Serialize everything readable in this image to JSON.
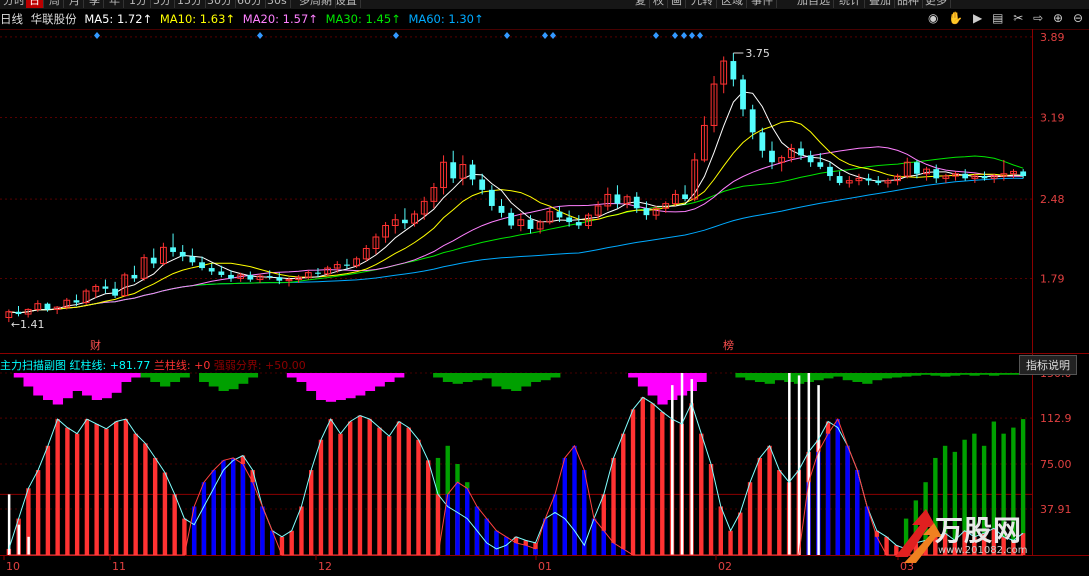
{
  "toolbar": {
    "left": [
      {
        "label": "分时",
        "active": false
      },
      {
        "label": "日",
        "active": true
      },
      {
        "label": "周",
        "active": false
      },
      {
        "label": "月",
        "active": false
      },
      {
        "label": "季",
        "active": false
      },
      {
        "label": "年",
        "active": false
      },
      {
        "label": "1分",
        "active": false
      },
      {
        "label": "5分",
        "active": false
      },
      {
        "label": "15分",
        "active": false
      },
      {
        "label": "30分",
        "active": false
      },
      {
        "label": "60分",
        "active": false
      },
      {
        "label": "30s",
        "active": false
      },
      {
        "label": "多周期",
        "active": false
      },
      {
        "label": "设置",
        "active": false
      }
    ],
    "right": [
      "复",
      "权",
      "画",
      "九转",
      "区域",
      "事件",
      "加自选",
      "统计",
      "叠加",
      "品种",
      "更多"
    ]
  },
  "header": {
    "period": "日线",
    "stock_name": "华联股份",
    "ma5": "MA5: 1.72↑",
    "ma10": "MA10: 1.63↑",
    "ma20": "MA20: 1.57↑",
    "ma30": "MA30: 1.45↑",
    "ma60": "MA60: 1.30↑"
  },
  "colors": {
    "up": "#ff3232",
    "down": "#54fcfc",
    "ma5": "#ffffff",
    "ma10": "#ffff00",
    "ma20": "#ff80ff",
    "ma30": "#00e600",
    "ma60": "#00aaff",
    "grid": "#8b0000",
    "magenta": "#ff00ff",
    "green": "#00a000",
    "blue": "#0000ff"
  },
  "price_axis": [
    "3.89",
    "3.19",
    "2.48",
    "1.79"
  ],
  "price_annotations": {
    "high": "3.75",
    "low": "1.41"
  },
  "event_markers": [
    "财",
    "榜"
  ],
  "indicator": {
    "name": "主力扫描副图",
    "red_line": "红柱线: +81.77",
    "blue_line": "兰柱线: +0",
    "boundary": "强弱分界: +50.00",
    "help_button": "指标说明",
    "axis": [
      "150.0",
      "112.9",
      "75.00",
      "37.91"
    ]
  },
  "x_axis": [
    "10",
    "11",
    "12",
    "01",
    "02",
    "03"
  ],
  "watermark": "万股网",
  "watermark_url": "www.201082.com",
  "toolbar_icons": [
    "eye-icon",
    "hand-icon",
    "play-icon",
    "chart-icon",
    "scissors-icon",
    "arrow-icon",
    "zoom-in-icon",
    "zoom-out-icon"
  ],
  "chart_data": {
    "type": "candlestick",
    "price_range": [
      1.41,
      3.89
    ],
    "ohlc": [
      [
        1.45,
        1.52,
        1.41,
        1.5
      ],
      [
        1.5,
        1.55,
        1.46,
        1.48
      ],
      [
        1.48,
        1.53,
        1.45,
        1.52
      ],
      [
        1.52,
        1.6,
        1.5,
        1.57
      ],
      [
        1.57,
        1.58,
        1.5,
        1.52
      ],
      [
        1.52,
        1.55,
        1.48,
        1.54
      ],
      [
        1.54,
        1.62,
        1.52,
        1.6
      ],
      [
        1.6,
        1.65,
        1.55,
        1.58
      ],
      [
        1.58,
        1.7,
        1.56,
        1.68
      ],
      [
        1.68,
        1.74,
        1.62,
        1.72
      ],
      [
        1.72,
        1.78,
        1.66,
        1.7
      ],
      [
        1.7,
        1.76,
        1.62,
        1.64
      ],
      [
        1.64,
        1.84,
        1.63,
        1.82
      ],
      [
        1.82,
        1.9,
        1.76,
        1.79
      ],
      [
        1.79,
        2.0,
        1.77,
        1.97
      ],
      [
        1.97,
        2.05,
        1.88,
        1.92
      ],
      [
        1.92,
        2.1,
        1.9,
        2.06
      ],
      [
        2.06,
        2.18,
        1.98,
        2.02
      ],
      [
        2.02,
        2.08,
        1.94,
        1.98
      ],
      [
        1.98,
        2.05,
        1.9,
        1.93
      ],
      [
        1.93,
        1.98,
        1.86,
        1.88
      ],
      [
        1.88,
        1.92,
        1.82,
        1.85
      ],
      [
        1.85,
        1.9,
        1.8,
        1.82
      ],
      [
        1.82,
        1.86,
        1.76,
        1.79
      ],
      [
        1.79,
        1.84,
        1.76,
        1.82
      ],
      [
        1.82,
        1.85,
        1.76,
        1.78
      ],
      [
        1.78,
        1.83,
        1.75,
        1.81
      ],
      [
        1.81,
        1.86,
        1.78,
        1.8
      ],
      [
        1.8,
        1.84,
        1.74,
        1.77
      ],
      [
        1.77,
        1.8,
        1.72,
        1.78
      ],
      [
        1.78,
        1.82,
        1.75,
        1.8
      ],
      [
        1.8,
        1.86,
        1.78,
        1.84
      ],
      [
        1.84,
        1.88,
        1.8,
        1.83
      ],
      [
        1.83,
        1.9,
        1.81,
        1.88
      ],
      [
        1.88,
        1.94,
        1.84,
        1.91
      ],
      [
        1.91,
        1.96,
        1.87,
        1.9
      ],
      [
        1.9,
        1.98,
        1.88,
        1.96
      ],
      [
        1.96,
        2.08,
        1.94,
        2.05
      ],
      [
        2.05,
        2.18,
        2.0,
        2.15
      ],
      [
        2.15,
        2.28,
        2.1,
        2.25
      ],
      [
        2.25,
        2.35,
        2.18,
        2.3
      ],
      [
        2.3,
        2.4,
        2.22,
        2.27
      ],
      [
        2.27,
        2.38,
        2.24,
        2.35
      ],
      [
        2.35,
        2.5,
        2.3,
        2.46
      ],
      [
        2.46,
        2.62,
        2.4,
        2.58
      ],
      [
        2.58,
        2.86,
        2.52,
        2.8
      ],
      [
        2.8,
        2.9,
        2.62,
        2.66
      ],
      [
        2.66,
        2.86,
        2.6,
        2.78
      ],
      [
        2.78,
        2.82,
        2.6,
        2.65
      ],
      [
        2.65,
        2.7,
        2.52,
        2.56
      ],
      [
        2.56,
        2.6,
        2.38,
        2.42
      ],
      [
        2.42,
        2.48,
        2.32,
        2.36
      ],
      [
        2.36,
        2.4,
        2.22,
        2.25
      ],
      [
        2.25,
        2.36,
        2.2,
        2.3
      ],
      [
        2.3,
        2.34,
        2.18,
        2.22
      ],
      [
        2.22,
        2.3,
        2.18,
        2.28
      ],
      [
        2.28,
        2.4,
        2.26,
        2.37
      ],
      [
        2.37,
        2.42,
        2.28,
        2.32
      ],
      [
        2.32,
        2.38,
        2.24,
        2.28
      ],
      [
        2.28,
        2.34,
        2.22,
        2.25
      ],
      [
        2.25,
        2.36,
        2.22,
        2.34
      ],
      [
        2.34,
        2.46,
        2.3,
        2.42
      ],
      [
        2.42,
        2.58,
        2.38,
        2.52
      ],
      [
        2.52,
        2.6,
        2.4,
        2.44
      ],
      [
        2.44,
        2.52,
        2.4,
        2.5
      ],
      [
        2.5,
        2.54,
        2.36,
        2.4
      ],
      [
        2.4,
        2.46,
        2.3,
        2.34
      ],
      [
        2.34,
        2.42,
        2.3,
        2.4
      ],
      [
        2.4,
        2.46,
        2.36,
        2.44
      ],
      [
        2.44,
        2.56,
        2.42,
        2.52
      ],
      [
        2.52,
        2.6,
        2.46,
        2.48
      ],
      [
        2.48,
        2.88,
        2.46,
        2.82
      ],
      [
        2.82,
        3.2,
        2.8,
        3.12
      ],
      [
        3.12,
        3.55,
        3.06,
        3.48
      ],
      [
        3.48,
        3.72,
        3.4,
        3.68
      ],
      [
        3.68,
        3.75,
        3.46,
        3.52
      ],
      [
        3.52,
        3.56,
        3.2,
        3.26
      ],
      [
        3.26,
        3.3,
        3.0,
        3.06
      ],
      [
        3.06,
        3.1,
        2.84,
        2.9
      ],
      [
        2.9,
        2.98,
        2.74,
        2.8
      ],
      [
        2.8,
        2.86,
        2.72,
        2.84
      ],
      [
        2.84,
        2.96,
        2.8,
        2.92
      ],
      [
        2.92,
        2.98,
        2.82,
        2.86
      ],
      [
        2.86,
        2.9,
        2.76,
        2.8
      ],
      [
        2.8,
        2.88,
        2.74,
        2.76
      ],
      [
        2.76,
        2.8,
        2.64,
        2.68
      ],
      [
        2.68,
        2.72,
        2.6,
        2.62
      ],
      [
        2.62,
        2.68,
        2.58,
        2.64
      ],
      [
        2.64,
        2.7,
        2.6,
        2.66
      ],
      [
        2.66,
        2.7,
        2.6,
        2.64
      ],
      [
        2.64,
        2.68,
        2.6,
        2.62
      ],
      [
        2.62,
        2.66,
        2.58,
        2.64
      ],
      [
        2.64,
        2.7,
        2.6,
        2.68
      ],
      [
        2.68,
        2.84,
        2.66,
        2.8
      ],
      [
        2.8,
        2.82,
        2.66,
        2.7
      ],
      [
        2.7,
        2.76,
        2.64,
        2.74
      ],
      [
        2.74,
        2.78,
        2.62,
        2.66
      ],
      [
        2.66,
        2.7,
        2.62,
        2.68
      ],
      [
        2.68,
        2.72,
        2.64,
        2.7
      ],
      [
        2.7,
        2.74,
        2.64,
        2.66
      ],
      [
        2.66,
        2.7,
        2.62,
        2.68
      ],
      [
        2.68,
        2.72,
        2.64,
        2.66
      ],
      [
        2.66,
        2.7,
        2.62,
        2.68
      ],
      [
        2.68,
        2.82,
        2.64,
        2.7
      ],
      [
        2.7,
        2.74,
        2.66,
        2.72
      ],
      [
        2.72,
        2.74,
        2.66,
        2.68
      ]
    ],
    "indicator_red": [
      5,
      30,
      55,
      70,
      90,
      112,
      105,
      100,
      112,
      108,
      104,
      110,
      112,
      100,
      92,
      80,
      68,
      50,
      30,
      25,
      40,
      55,
      70,
      78,
      82,
      70,
      40,
      20,
      15,
      20,
      40,
      70,
      95,
      112,
      100,
      110,
      115,
      112,
      105,
      98,
      110,
      105,
      95,
      78,
      50,
      40,
      35,
      30,
      20,
      10,
      5,
      8,
      15,
      12,
      10,
      30,
      35,
      30,
      20,
      8,
      30,
      50,
      80,
      100,
      120,
      130,
      125,
      118,
      112,
      108,
      125,
      100,
      75,
      40,
      20,
      35,
      60,
      80,
      90,
      70,
      60,
      70,
      85,
      95,
      110,
      105,
      90,
      70,
      40,
      20,
      15,
      8,
      5,
      10,
      12,
      15,
      18,
      12,
      20,
      15,
      18,
      22,
      15,
      12,
      18
    ],
    "indicator_blue": [
      0,
      0,
      0,
      0,
      0,
      0,
      0,
      0,
      0,
      0,
      0,
      0,
      0,
      0,
      0,
      0,
      0,
      0,
      0,
      40,
      60,
      70,
      78,
      80,
      75,
      60,
      40,
      20,
      0,
      0,
      0,
      0,
      0,
      0,
      0,
      0,
      0,
      0,
      0,
      0,
      0,
      0,
      0,
      0,
      0,
      50,
      60,
      55,
      40,
      30,
      20,
      15,
      10,
      8,
      5,
      30,
      50,
      80,
      90,
      70,
      30,
      20,
      10,
      5,
      0,
      0,
      0,
      0,
      0,
      0,
      0,
      0,
      0,
      0,
      0,
      0,
      0,
      0,
      0,
      0,
      0,
      0,
      60,
      85,
      100,
      112,
      90,
      70,
      40,
      15,
      0,
      0,
      0,
      0,
      0,
      0,
      0,
      0,
      0,
      0,
      0,
      0,
      0,
      0,
      0
    ],
    "indicator_magenta": [
      0,
      5,
      15,
      25,
      30,
      35,
      28,
      20,
      25,
      30,
      28,
      22,
      10,
      5,
      0,
      0,
      0,
      0,
      0,
      0,
      0,
      0,
      0,
      0,
      0,
      0,
      0,
      0,
      0,
      5,
      10,
      20,
      30,
      32,
      30,
      28,
      25,
      20,
      15,
      10,
      5,
      0,
      0,
      0,
      0,
      0,
      0,
      0,
      0,
      0,
      0,
      0,
      0,
      0,
      0,
      0,
      0,
      0,
      0,
      0,
      0,
      0,
      0,
      0,
      5,
      15,
      25,
      35,
      30,
      25,
      20,
      10,
      0,
      0,
      0,
      0,
      0,
      0,
      0,
      0,
      0,
      0,
      0,
      0,
      0,
      0,
      0,
      0,
      0,
      0,
      0,
      0,
      0,
      0,
      0,
      0,
      0,
      0,
      0,
      0,
      0,
      0,
      0,
      0,
      0
    ],
    "indicator_green_top": [
      0,
      0,
      0,
      0,
      0,
      0,
      0,
      0,
      0,
      0,
      0,
      0,
      0,
      0,
      5,
      10,
      15,
      10,
      5,
      0,
      10,
      15,
      20,
      18,
      12,
      5,
      0,
      0,
      0,
      0,
      0,
      0,
      0,
      0,
      0,
      0,
      0,
      0,
      0,
      0,
      0,
      0,
      0,
      0,
      5,
      10,
      12,
      10,
      8,
      6,
      15,
      18,
      20,
      15,
      10,
      8,
      5,
      0,
      0,
      0,
      0,
      0,
      0,
      0,
      0,
      0,
      0,
      0,
      0,
      0,
      0,
      0,
      0,
      0,
      0,
      5,
      8,
      10,
      12,
      8,
      10,
      12,
      10,
      8,
      6,
      4,
      8,
      10,
      12,
      8,
      6,
      5,
      4,
      3,
      2,
      3,
      4,
      3,
      2,
      3,
      2,
      3,
      2,
      2,
      2
    ],
    "indicator_green_bottom": [
      0,
      0,
      0,
      0,
      0,
      0,
      0,
      0,
      0,
      0,
      0,
      0,
      0,
      0,
      0,
      0,
      0,
      0,
      0,
      0,
      0,
      0,
      0,
      0,
      0,
      0,
      0,
      0,
      0,
      0,
      0,
      0,
      0,
      0,
      0,
      0,
      0,
      0,
      0,
      0,
      0,
      0,
      0,
      60,
      80,
      90,
      75,
      60,
      40,
      30,
      20,
      10,
      5,
      0,
      0,
      0,
      0,
      0,
      0,
      0,
      0,
      0,
      0,
      0,
      0,
      0,
      0,
      0,
      0,
      0,
      0,
      0,
      0,
      0,
      0,
      0,
      0,
      0,
      0,
      0,
      0,
      0,
      0,
      0,
      0,
      0,
      0,
      0,
      0,
      0,
      0,
      0,
      30,
      45,
      60,
      80,
      90,
      85,
      95,
      100,
      90,
      110,
      100,
      105,
      112
    ]
  }
}
